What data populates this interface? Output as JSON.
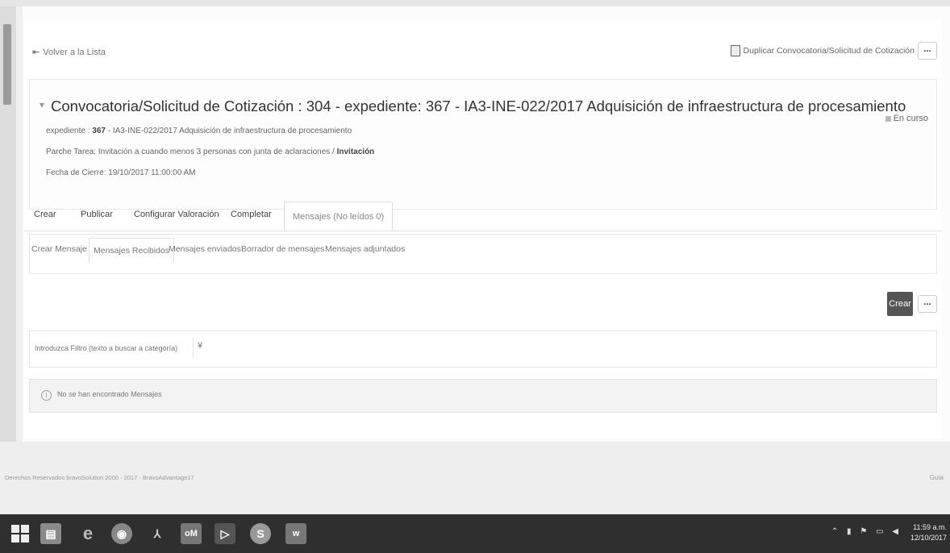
{
  "top_actions": {
    "back_label": "Volver a la Lista",
    "duplicate_label": "Duplicar Convocatoria/Solicitud de Cotización",
    "more_label": "..."
  },
  "header": {
    "title": "Convocatoria/Solicitud de Cotización : 304 - expediente: 367 - IA3-INE-022/2017 Adquisición de infraestructura de procesamiento",
    "status": "En curso",
    "expediente_label": "expediente :",
    "expediente_number": "367",
    "expediente_desc": "- IA3-INE-022/2017 Adquisición de infraestructura de procesamiento",
    "patch_label": "Parche Tarea:",
    "patch_value": "Invitación a cuando menos 3 personas con junta de aclaraciones /",
    "patch_bold": "Invitación",
    "close_date_label": "Fecha de Cierre:",
    "close_date_value": "19/10/2017 11:00:00 AM"
  },
  "tabs": [
    "Crear",
    "Publicar",
    "Configurar Valoración",
    "Completar",
    "Mensajes (No leídos 0)"
  ],
  "subtabs": [
    "Crear Mensaje",
    "Mensajes Recibidos",
    "Mensajes enviados",
    "Borrador de mensajes",
    "Mensajes adjuntados"
  ],
  "actions": {
    "crear_label": "Crear",
    "more_label": "..."
  },
  "filter": {
    "placeholder": "Introduzca Filtro (texto a buscar a categoría)",
    "toggle_icon": "double-chevron-down-icon"
  },
  "empty_state": {
    "icon": "info-icon",
    "text": "No se han encontrado Mensajes"
  },
  "footer": {
    "left": "Derechos Reservados bravoSolution 2000 - 2017 - BravoAdvantage17",
    "right": "Guía"
  },
  "taskbar": {
    "apps": [
      "start-icon",
      "file-explorer-icon",
      "internet-explorer-icon",
      "chrome-icon",
      "acrobat-icon",
      "outlook-icon",
      "media-icon",
      "skype-icon",
      "word-icon"
    ],
    "time": "11:59 a.m.",
    "date": "12/10/2017"
  }
}
